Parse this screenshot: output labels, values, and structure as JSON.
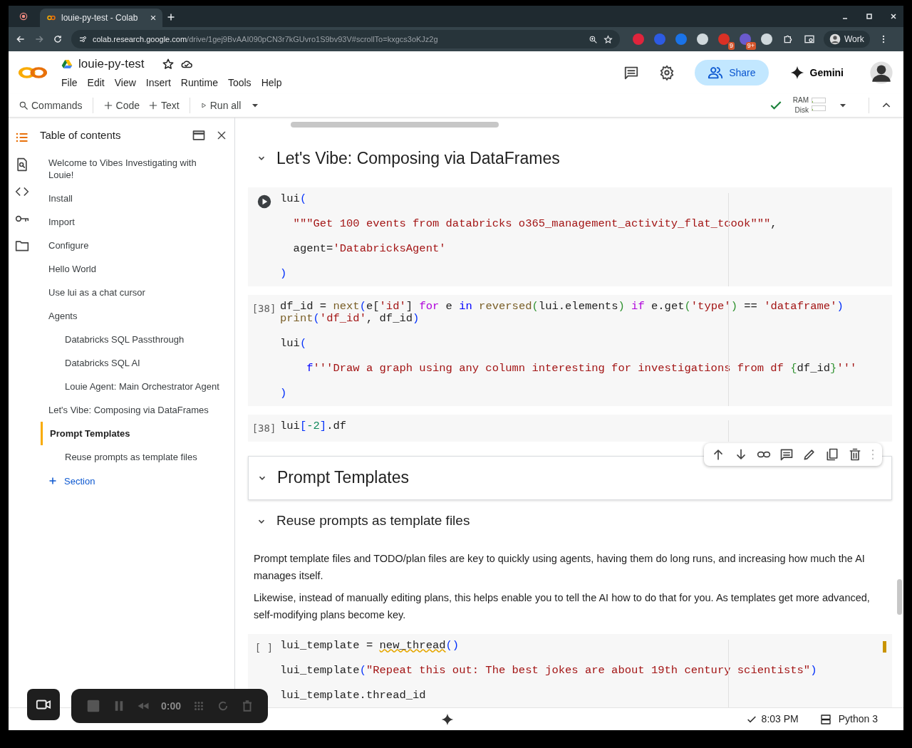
{
  "browser": {
    "tab": {
      "title": "louie-py-test - Colab"
    },
    "address": {
      "host": "colab.research.google.com",
      "path": "/drive/1gej9BvAAI090pCN3r7kGUvro1S9bv93V#scrollTo=kxgcs3oKJz2g"
    },
    "extensions": [
      {
        "color": "#e0243c"
      },
      {
        "color": "#2d5be3"
      },
      {
        "color": "#1a73e8"
      },
      {
        "color": "#cfd8dc"
      },
      {
        "color": "#d93025",
        "badge": "9"
      },
      {
        "color": "#6a5acd",
        "badge": "9+"
      },
      {
        "color": "#cfd8dc"
      }
    ],
    "profile": "Work"
  },
  "notebook": {
    "title": "louie-py-test",
    "menu": [
      "File",
      "Edit",
      "View",
      "Insert",
      "Runtime",
      "Tools",
      "Help"
    ],
    "share": "Share",
    "gemini": "Gemini"
  },
  "toolbar": {
    "commands": "Commands",
    "add_code": "Code",
    "add_text": "Text",
    "run_all": "Run all",
    "connected": true,
    "ram": {
      "label": "RAM",
      "level": 0.06
    },
    "disk": {
      "label": "Disk",
      "level": 0.06
    }
  },
  "toc": {
    "title": "Table of contents",
    "items": [
      {
        "label": "Welcome to Vibes Investigating with Louie!",
        "selected": false
      },
      {
        "label": "Install",
        "selected": false
      },
      {
        "label": "Import",
        "selected": false
      },
      {
        "label": "Configure",
        "selected": false
      },
      {
        "label": "Hello World",
        "selected": false
      },
      {
        "label": "Use lui as a chat cursor",
        "selected": false
      },
      {
        "label": "Agents",
        "selected": false,
        "children": [
          {
            "label": "Databricks SQL Passthrough",
            "selected": false
          },
          {
            "label": "Databricks SQL AI",
            "selected": false
          },
          {
            "label": "Louie Agent: Main Orchestrator Agent",
            "selected": false
          }
        ]
      },
      {
        "label": "Let's Vibe: Composing via DataFrames",
        "selected": false
      },
      {
        "label": "Prompt Templates",
        "selected": true,
        "children": [
          {
            "label": "Reuse prompts as template files",
            "selected": false
          }
        ]
      }
    ],
    "add_section": "Section"
  },
  "cells": [
    {
      "kind": "heading",
      "text": "Let's Vibe: Composing via DataFrames",
      "expanded": true,
      "selected": false
    },
    {
      "kind": "code",
      "run_button": true,
      "modified": false,
      "lines": [
        {
          "blank_before": false,
          "tokens": [
            {
              "t": "lui",
              "kind": "plain"
            },
            {
              "t": "(",
              "kind": "paren"
            }
          ]
        },
        {
          "blank_before": true,
          "tokens": [
            {
              "t": "  \"\"\"Get 100 events from databricks o365_management_activity_flat_tcook\"\"\"",
              "kind": "str"
            },
            {
              "t": ",",
              "kind": "plain"
            }
          ]
        },
        {
          "blank_before": true,
          "tokens": [
            {
              "t": "  agent=",
              "kind": "plain"
            },
            {
              "t": "'DatabricksAgent'",
              "kind": "str"
            }
          ]
        },
        {
          "blank_before": true,
          "tokens": [
            {
              "t": ")",
              "kind": "paren"
            }
          ]
        }
      ]
    },
    {
      "kind": "code",
      "run_button": false,
      "prompt": "[38]",
      "modified": false,
      "lines": [
        {
          "blank_before": false,
          "tokens": [
            {
              "t": "df_id = ",
              "kind": "plain"
            },
            {
              "t": "next",
              "kind": "fn"
            },
            {
              "t": "(",
              "kind": "paren"
            },
            {
              "t": "e[",
              "kind": "plain"
            },
            {
              "t": "'id'",
              "kind": "str"
            },
            {
              "t": "] ",
              "kind": "plain"
            },
            {
              "t": "for",
              "kind": "kw"
            },
            {
              "t": " e ",
              "kind": "plain"
            },
            {
              "t": "in",
              "kind": "op"
            },
            {
              "t": " reversed",
              "kind": "fn"
            },
            {
              "t": "(",
              "kind": "paren2"
            },
            {
              "t": "lui.elements",
              "kind": "plain"
            },
            {
              "t": ")",
              "kind": "paren2"
            },
            {
              "t": " if",
              "kind": "kw"
            },
            {
              "t": " e.get",
              "kind": "plain"
            },
            {
              "t": "(",
              "kind": "paren2"
            },
            {
              "t": "'type'",
              "kind": "str"
            },
            {
              "t": ")",
              "kind": "paren2"
            },
            {
              "t": " == ",
              "kind": "plain"
            },
            {
              "t": "'dataframe'",
              "kind": "str"
            },
            {
              "t": ")",
              "kind": "paren"
            }
          ]
        },
        {
          "blank_before": false,
          "tokens": [
            {
              "t": "print",
              "kind": "fn"
            },
            {
              "t": "(",
              "kind": "paren"
            },
            {
              "t": "'df_id'",
              "kind": "str"
            },
            {
              "t": ", df_id",
              "kind": "plain"
            },
            {
              "t": ")",
              "kind": "paren"
            }
          ]
        },
        {
          "blank_before": true,
          "tokens": [
            {
              "t": "lui",
              "kind": "plain"
            },
            {
              "t": "(",
              "kind": "paren"
            }
          ]
        },
        {
          "blank_before": true,
          "tokens": [
            {
              "t": "    f",
              "kind": "op"
            },
            {
              "t": "'''Draw a graph using any column interesting for investigations from df ",
              "kind": "str"
            },
            {
              "t": "{",
              "kind": "paren2"
            },
            {
              "t": "df_id",
              "kind": "plain"
            },
            {
              "t": "}",
              "kind": "paren2"
            },
            {
              "t": "'''",
              "kind": "str"
            }
          ]
        },
        {
          "blank_before": true,
          "tokens": [
            {
              "t": ")",
              "kind": "paren"
            }
          ]
        }
      ]
    },
    {
      "kind": "code",
      "run_button": false,
      "prompt": "[38]",
      "modified": false,
      "lines": [
        {
          "blank_before": false,
          "tokens": [
            {
              "t": "lui",
              "kind": "plain"
            },
            {
              "t": "[",
              "kind": "paren"
            },
            {
              "t": "-2",
              "kind": "num"
            },
            {
              "t": "]",
              "kind": "paren"
            },
            {
              "t": ".df",
              "kind": "plain"
            }
          ]
        }
      ]
    },
    {
      "kind": "heading",
      "text": "Prompt Templates",
      "expanded": true,
      "selected": true
    },
    {
      "kind": "subheading",
      "text": "Reuse prompts as template files",
      "expanded": true,
      "selected": false
    },
    {
      "kind": "text",
      "paragraphs": [
        "Prompt template files and TODO/plan files are key to quickly using agents, having them do long runs, and increasing how much the AI manages itself.",
        "Likewise, instead of manually editing plans, this helps enable you to tell the AI how to do that for you. As templates get more advanced, self-modifying plans become key."
      ]
    },
    {
      "kind": "code",
      "run_button": false,
      "prompt": "[ ]",
      "modified": true,
      "lines": [
        {
          "blank_before": false,
          "tokens": [
            {
              "t": "lui_template = ",
              "kind": "plain"
            },
            {
              "t": "new_thread",
              "kind": "warn"
            },
            {
              "t": "()",
              "kind": "paren"
            }
          ]
        },
        {
          "blank_before": true,
          "tokens": [
            {
              "t": "lui_template",
              "kind": "plain"
            },
            {
              "t": "(",
              "kind": "paren"
            },
            {
              "t": "\"Repeat this out: The best jokes are about 19th century scientists\"",
              "kind": "str"
            },
            {
              "t": ")",
              "kind": "paren"
            }
          ]
        },
        {
          "blank_before": true,
          "tokens": [
            {
              "t": "lui_template.thread_id",
              "kind": "plain"
            }
          ]
        }
      ]
    }
  ],
  "recorder": {
    "time": "0:00"
  },
  "status_bar": {
    "saved": true,
    "time": "8:03 PM",
    "runtime": "Python 3"
  }
}
